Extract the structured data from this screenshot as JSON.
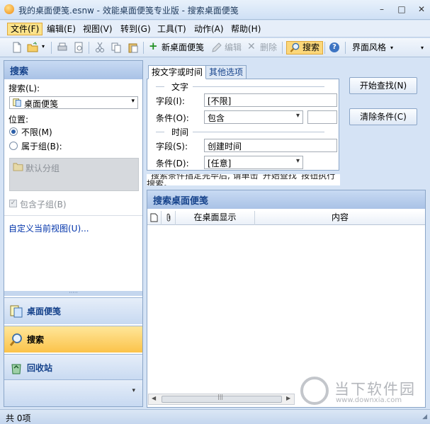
{
  "window": {
    "title": "我的桌面便笺.esnw - 效能桌面便笺专业版 - 搜索桌面便笺",
    "minimize": "–",
    "maximize": "□",
    "close": "✕"
  },
  "menubar": {
    "items": [
      "文件(F)",
      "编辑(E)",
      "视图(V)",
      "转到(G)",
      "工具(T)",
      "动作(A)",
      "帮助(H)"
    ]
  },
  "toolbar": {
    "new_note": "新桌面便笺",
    "edit": "编辑",
    "delete": "删除",
    "search": "搜索",
    "ui_style": "界面风格"
  },
  "left_panel": {
    "header": "搜索",
    "search_label": "搜索(L):",
    "search_value": "桌面便笺",
    "position_label": "位置:",
    "option_unlimited": "不限(M)",
    "option_group": "属于组(B):",
    "default_group": "默认分组",
    "include_subgroups": "包含子组(B)",
    "custom_view": "自定义当前视图(U)..."
  },
  "nav": {
    "items": [
      {
        "label": "桌面便笺",
        "icon": "notes-icon"
      },
      {
        "label": "搜索",
        "icon": "magnifier-icon"
      },
      {
        "label": "回收站",
        "icon": "recycle-bin-icon"
      }
    ]
  },
  "search_form": {
    "tabs": [
      "按文字或时间",
      "其他选项"
    ],
    "text_section": "文字",
    "time_section": "时间",
    "field_label_1": "字段(I):",
    "field_value_1": "[不限]",
    "condition_label_1": "条件(O):",
    "condition_value_1": "包含",
    "condition_text_1": "",
    "field_label_2": "字段(S):",
    "field_value_2": "创建时间",
    "condition_label_2": "条件(D):",
    "condition_value_2": "[任意]",
    "hint": "搜索条件指定完毕后, 请单击“开始查找”按钮执行搜索。",
    "start_button": "开始查找(N)",
    "clear_button": "清除条件(C)"
  },
  "results": {
    "header": "搜索桌面便笺",
    "columns": [
      "",
      "",
      "在桌面显示",
      "内容"
    ]
  },
  "statusbar": {
    "text": "共 0项"
  },
  "watermark": {
    "title": "当下软件园",
    "url": "www.downxia.com"
  },
  "colors": {
    "accent": "#15428b",
    "highlight": "#fbc34a",
    "panel_border": "#8ba6c8"
  }
}
